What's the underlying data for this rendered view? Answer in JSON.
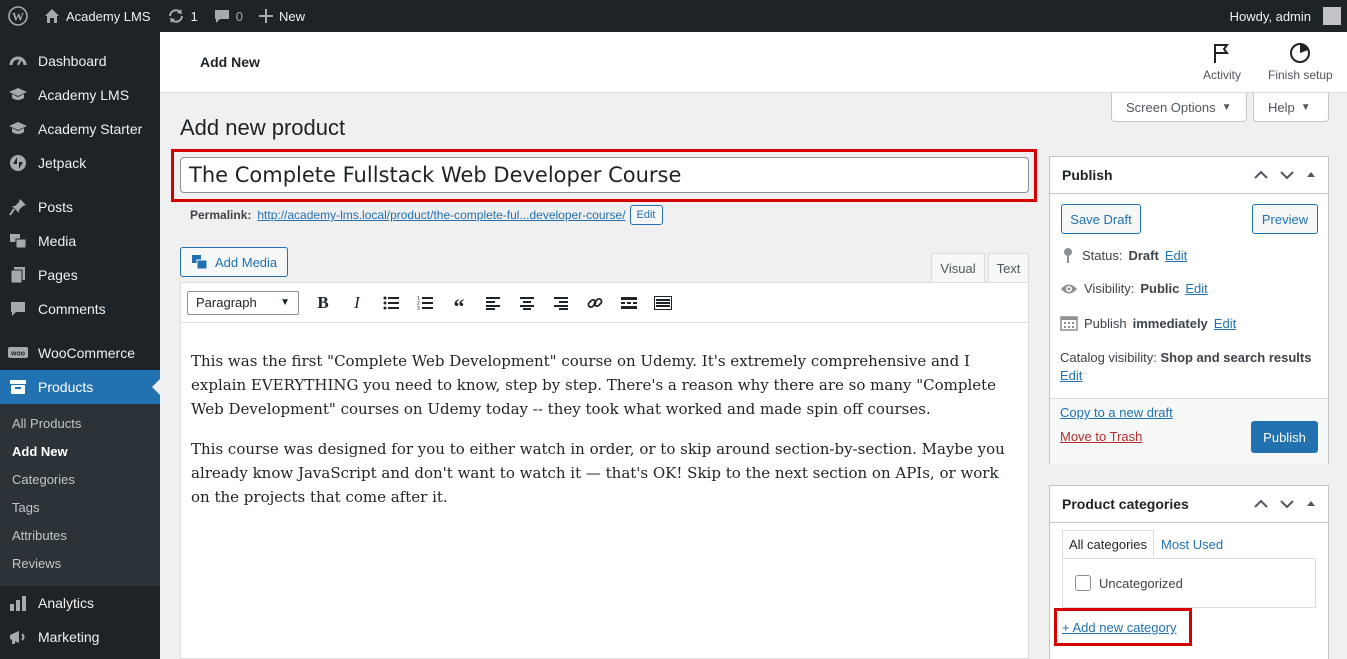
{
  "adminbar": {
    "site_name": "Academy LMS",
    "updates_count": "1",
    "comments_count": "0",
    "new_label": "New",
    "howdy": "Howdy, admin"
  },
  "sidebar": {
    "items": [
      {
        "label": "Dashboard",
        "icon": "dashboard-icon"
      },
      {
        "label": "Academy LMS",
        "icon": "graduation-cap-icon"
      },
      {
        "label": "Academy Starter",
        "icon": "graduation-cap-icon"
      },
      {
        "label": "Jetpack",
        "icon": "jetpack-icon"
      },
      {
        "label": "Posts",
        "icon": "pin-icon"
      },
      {
        "label": "Media",
        "icon": "media-icon"
      },
      {
        "label": "Pages",
        "icon": "pages-icon"
      },
      {
        "label": "Comments",
        "icon": "comment-icon"
      },
      {
        "label": "WooCommerce",
        "icon": "woocommerce-icon"
      },
      {
        "label": "Products",
        "icon": "archive-icon"
      },
      {
        "label": "Analytics",
        "icon": "bar-chart-icon"
      },
      {
        "label": "Marketing",
        "icon": "megaphone-icon"
      }
    ],
    "submenu": [
      "All Products",
      "Add New",
      "Categories",
      "Tags",
      "Attributes",
      "Reviews"
    ]
  },
  "header": {
    "page_tab": "Add New",
    "activity": "Activity",
    "finish_setup": "Finish setup",
    "screen_options": "Screen Options",
    "help": "Help"
  },
  "main": {
    "title": "Add new product",
    "product_title": "The Complete Fullstack Web Developer Course",
    "permalink_label": "Permalink:",
    "permalink_base": "http://academy-lms.local/product/",
    "permalink_slug": "the-complete-ful...developer-course/",
    "permalink_edit": "Edit",
    "add_media": "Add Media",
    "tab_visual": "Visual",
    "tab_text": "Text",
    "format_select": "Paragraph",
    "content": [
      "This was the first \"Complete Web Development\" course on Udemy. It's extremely comprehensive and I explain EVERYTHING you need to know, step by step. There's a reason why there are so many \"Complete Web Development\" courses on Udemy today -- they took what worked and made spin off courses.",
      "This course was designed for you to either watch in order, or to skip around section-by-section. Maybe you already know JavaScript and don't want to watch it — that's OK! Skip to the next section on APIs, or work on the projects that come after it."
    ]
  },
  "publish": {
    "title": "Publish",
    "save_draft": "Save Draft",
    "preview": "Preview",
    "status_label": "Status:",
    "status_value": "Draft",
    "visibility_label": "Visibility:",
    "visibility_value": "Public",
    "publish_label": "Publish",
    "publish_value": "immediately",
    "catalog_label": "Catalog visibility:",
    "catalog_value": "Shop and search results",
    "edit": "Edit",
    "copy_draft": "Copy to a new draft",
    "move_trash": "Move to Trash",
    "publish_button": "Publish"
  },
  "categories": {
    "title": "Product categories",
    "tab_all": "All categories",
    "tab_most_used": "Most Used",
    "items": [
      "Uncategorized"
    ],
    "add_new": "+ Add new category"
  },
  "colors": {
    "accent": "#2271b1",
    "admin_dark": "#1d2327",
    "highlight_red": "#d60000",
    "trash_red": "#b32d2e"
  }
}
